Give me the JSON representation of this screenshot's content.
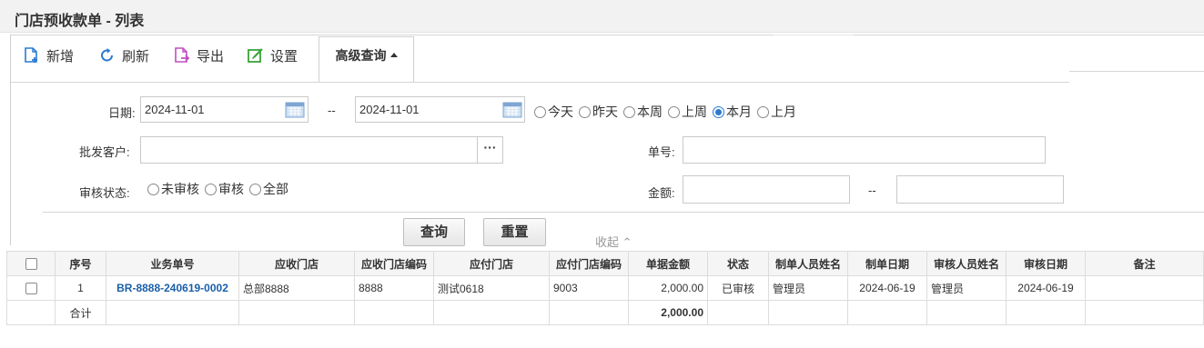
{
  "page": {
    "title": "门店预收款单 - 列表"
  },
  "toolbar": {
    "new_label": "新增",
    "refresh_label": "刷新",
    "export_label": "导出",
    "settings_label": "设置",
    "advanced_tab_label": "高级查询"
  },
  "filters": {
    "date_label": "日期:",
    "date_from": "2024-11-01",
    "date_sep": "--",
    "date_to": "2024-11-01",
    "date_ranges": [
      {
        "label": "今天",
        "selected": false
      },
      {
        "label": "昨天",
        "selected": false
      },
      {
        "label": "本周",
        "selected": false
      },
      {
        "label": "上周",
        "selected": false
      },
      {
        "label": "本月",
        "selected": true
      },
      {
        "label": "上月",
        "selected": false
      }
    ],
    "customer_label": "批发客户:",
    "customer_value": "",
    "lookup_button": "···",
    "number_label": "单号:",
    "number_value": "",
    "status_label": "审核状态:",
    "status_options": [
      {
        "label": "未审核",
        "selected": false
      },
      {
        "label": "审核",
        "selected": false
      },
      {
        "label": "全部",
        "selected": false
      }
    ],
    "amount_label": "金额:",
    "amount_from": "",
    "amount_sep": "--",
    "amount_to": "",
    "query_button": "查询",
    "reset_button": "重置",
    "collapse_label": "收起 ⌃"
  },
  "table": {
    "headers": [
      "序号",
      "业务单号",
      "应收门店",
      "应收门店编码",
      "应付门店",
      "应付门店编码",
      "单据金额",
      "状态",
      "制单人员姓名",
      "制单日期",
      "审核人员姓名",
      "审核日期",
      "备注"
    ],
    "rows": [
      {
        "seq": "1",
        "doc_no": "BR-8888-240619-0002",
        "recv_store": "总部8888",
        "recv_code": "8888",
        "pay_store": "测试0618",
        "pay_code": "9003",
        "amount": "2,000.00",
        "status": "已审核",
        "creator": "管理员",
        "created": "2024-06-19",
        "reviewer": "管理员",
        "reviewed": "2024-06-19",
        "note": ""
      }
    ],
    "total_label": "合计",
    "total_amount": "2,000.00"
  },
  "colors": {
    "accent": "#2a7ad2",
    "link": "#1a5fa8"
  }
}
